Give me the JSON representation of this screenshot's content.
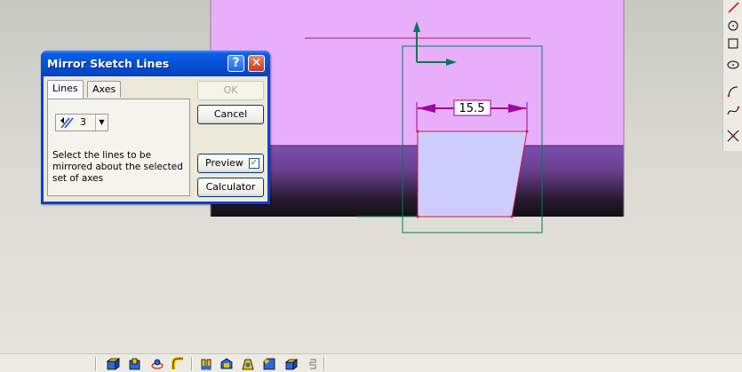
{
  "dialog": {
    "title": "Mirror Sketch Lines",
    "help_glyph": "?",
    "close_glyph": "✕",
    "tabs": [
      {
        "label": "Lines",
        "active": true
      },
      {
        "label": "Axes",
        "active": false
      }
    ],
    "lines_count": "3",
    "instruction": "Select the lines to be mirrored about the selected set of axes",
    "ok_label": "OK",
    "cancel_label": "Cancel",
    "preview_label": "Preview",
    "preview_checked": true,
    "calculator_label": "Calculator"
  },
  "sketch": {
    "dimension_value": "15.5"
  },
  "colors": {
    "sketch_background": "#e8aefa",
    "sketch_dark": "#1a1a1a",
    "shape_fill": "#cccdfd",
    "shape_edge": "#d0164a",
    "axis_color": "#007a55",
    "dimension_color": "#a000a0",
    "title_bar": "#0552d8"
  },
  "icons": {
    "right_toolbar": [
      "line-icon",
      "circle-icon",
      "rectangle-icon",
      "ellipse-icon",
      "arc-icon",
      "spline-icon",
      "trim-icon"
    ],
    "bottom_toolbar": [
      "extrude-icon",
      "cut-icon",
      "revolve-icon",
      "sweep-icon",
      "fillet-icon",
      "shell-icon",
      "draft-icon",
      "chamfer-icon",
      "pattern-icon",
      "mirror-feature-icon"
    ],
    "combo_icon": "select-lines-icon"
  }
}
